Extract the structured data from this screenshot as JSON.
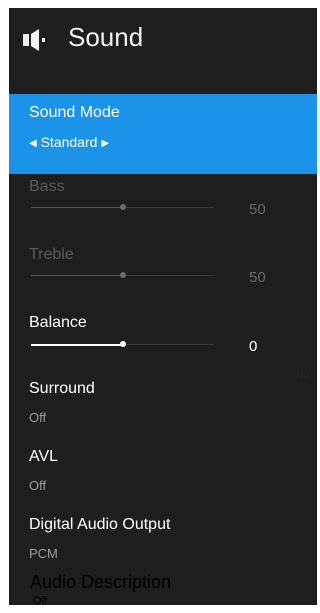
{
  "header": {
    "title": "Sound",
    "icon": "speaker-icon"
  },
  "items": {
    "sound_mode": {
      "label": "Sound Mode",
      "value": "Standard"
    },
    "bass": {
      "label": "Bass",
      "value": "50",
      "level": 50
    },
    "treble": {
      "label": "Treble",
      "value": "50",
      "level": 50
    },
    "balance": {
      "label": "Balance",
      "value": "0",
      "level": 0
    },
    "surround": {
      "label": "Surround",
      "value": "Off"
    },
    "avl": {
      "label": "AVL",
      "value": "Off"
    },
    "digital_audio_output": {
      "label": "Digital Audio Output",
      "value": "PCM"
    },
    "audio_description": {
      "label": "Audio Description",
      "value": "Off"
    }
  },
  "ghost_text": "No",
  "colors": {
    "accent": "#1a93e8",
    "background": "#1e1e1e"
  }
}
